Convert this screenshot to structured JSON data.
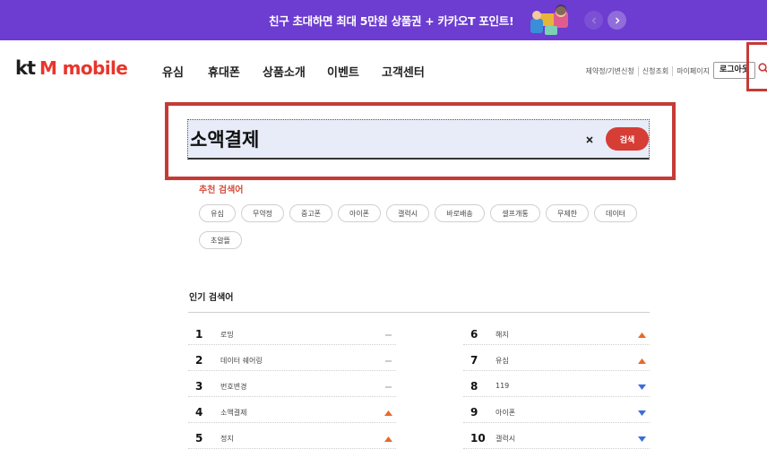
{
  "banner": {
    "text": "친구 초대하면 최대 5만원 상품권 + 카카오T 포인트!",
    "prev_icon": "chevron-left-icon",
    "next_icon": "chevron-right-icon",
    "color": "#6c3dd0"
  },
  "header": {
    "logo_kt": "kt",
    "logo_text": "M mobile",
    "nav": [
      "유심",
      "휴대폰",
      "상품소개",
      "이벤트",
      "고객센터"
    ],
    "util_links": [
      "제약정/기변신청",
      "신청조회",
      "마이페이지"
    ],
    "login_label": "로그아웃",
    "search_icon": "search-icon"
  },
  "search": {
    "value": "소액결제",
    "clear_icon": "close-icon",
    "button_label": "검색"
  },
  "recommended": {
    "title": "추천 검색어",
    "items": [
      "유심",
      "무약정",
      "중고폰",
      "아이폰",
      "갤럭시",
      "바로배송",
      "셀프개통",
      "무제한",
      "데이터",
      "초알뜰"
    ]
  },
  "popular": {
    "title": "인기 검색어",
    "items": [
      {
        "rank": "1",
        "word": "로밍",
        "trend": "same"
      },
      {
        "rank": "2",
        "word": "데이터 쉐어링",
        "trend": "same"
      },
      {
        "rank": "3",
        "word": "번호변경",
        "trend": "same"
      },
      {
        "rank": "4",
        "word": "소액결제",
        "trend": "up"
      },
      {
        "rank": "5",
        "word": "정지",
        "trend": "up"
      },
      {
        "rank": "6",
        "word": "해지",
        "trend": "up"
      },
      {
        "rank": "7",
        "word": "유심",
        "trend": "up"
      },
      {
        "rank": "8",
        "word": "119",
        "trend": "down"
      },
      {
        "rank": "9",
        "word": "아이폰",
        "trend": "down"
      },
      {
        "rank": "10",
        "word": "갤럭시",
        "trend": "down"
      }
    ]
  },
  "colors": {
    "accent": "#d53d35",
    "highlight": "#c53b37",
    "up": "#e8692a",
    "down": "#3b6fd8",
    "same": "#aaaaaa"
  }
}
